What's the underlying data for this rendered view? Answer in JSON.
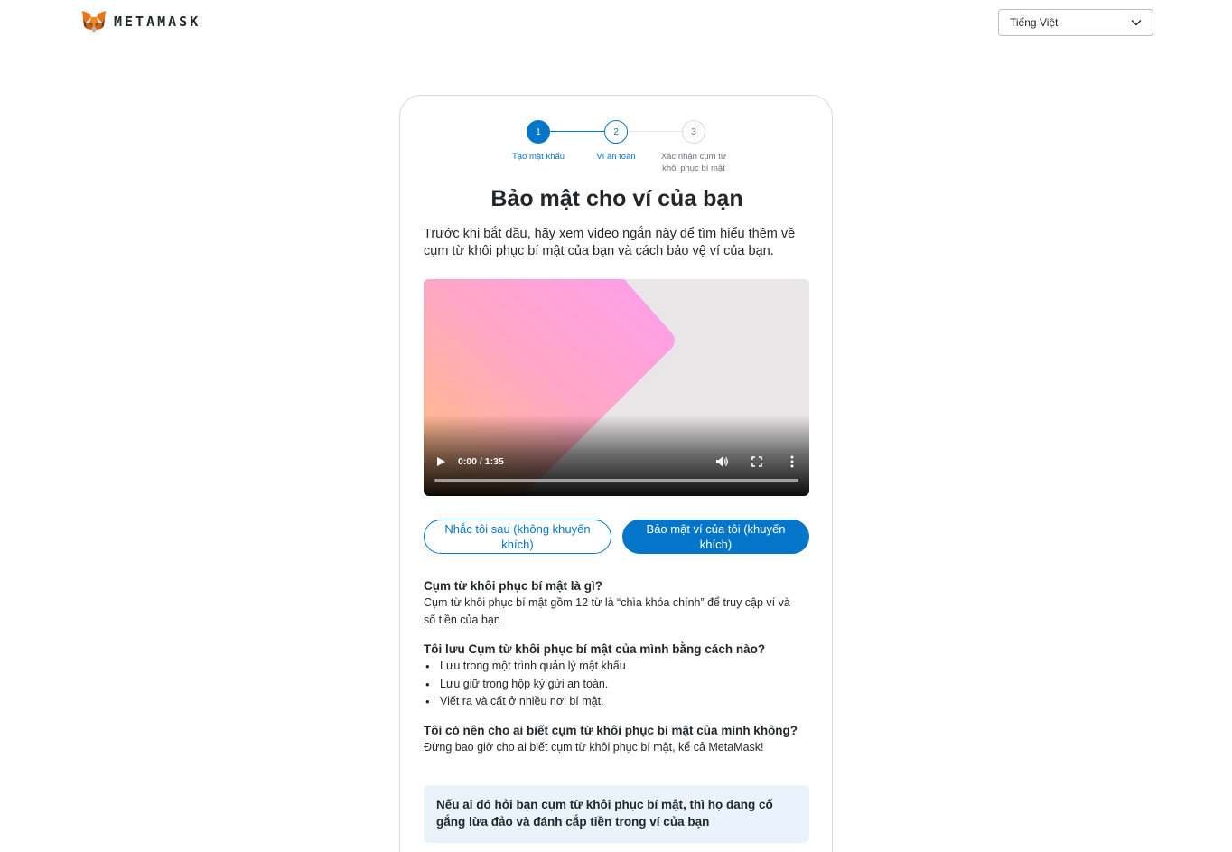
{
  "header": {
    "brand": "METAMASK",
    "language": {
      "selected": "Tiếng Việt"
    }
  },
  "stepper": {
    "steps": [
      {
        "number": "1",
        "label": "Tạo mật khẩu"
      },
      {
        "number": "2",
        "label": "Ví an toàn"
      },
      {
        "number": "3",
        "label": "Xác nhận cụm từ khôi phục bí mật"
      }
    ]
  },
  "main": {
    "title": "Bảo mật cho ví của bạn",
    "intro": "Trước khi bắt đầu, hãy xem video ngắn này để tìm hiểu thêm về cụm từ khôi phục bí mật của bạn và cách bảo vệ ví của bạn.",
    "video": {
      "time": "0:00 / 1:35"
    },
    "buttons": {
      "remind_later": "Nhắc tôi sau (không khuyến khích)",
      "secure_wallet": "Bảo mật ví của tôi (khuyến khích)"
    },
    "faq": [
      {
        "question": "Cụm từ khôi phục bí mật là gì?",
        "answer": "Cụm từ khôi phục bí mật gồm 12 từ là “chìa khóa chính” để truy cập ví và số tiền của bạn"
      },
      {
        "question": "Tôi lưu Cụm từ khôi phục bí mật của mình bằng cách nào?",
        "items": [
          "Lưu trong một trình quản lý mật khẩu",
          "Lưu giữ trong hộp ký gửi an toàn.",
          "Viết ra và cất ở nhiều nơi bí mật."
        ]
      },
      {
        "question": "Tôi có nên cho ai biết cụm từ khôi phục bí mật của mình không?",
        "answer": "Đừng bao giờ cho ai biết cụm từ khôi phục bí mật, kể cả MetaMask!"
      }
    ],
    "warning": "Nếu ai đó hỏi bạn cụm từ khôi phục bí mật, thì họ đang cố gắng lừa đảo và đánh cắp tiền trong ví của bạn"
  },
  "colors": {
    "accent": "#0376c9",
    "warning_bg": "#eaf3fb",
    "text": "#24272a"
  }
}
